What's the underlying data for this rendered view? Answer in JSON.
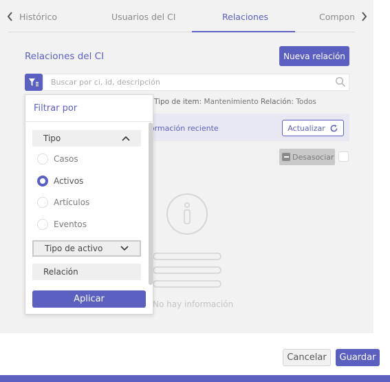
{
  "tabs": [
    {
      "label": "Histórico",
      "active": false
    },
    {
      "label": "Usuarios del CI",
      "active": false
    },
    {
      "label": "Relaciones",
      "active": true
    },
    {
      "label": "Compone",
      "active": false
    }
  ],
  "section": {
    "title": "Relaciones del CI",
    "new_button": "Nueva relación"
  },
  "search": {
    "placeholder": "Buscar por ci, id, descripción"
  },
  "filters_summary": {
    "tipo_item_label": "Tipo de item:",
    "tipo_item_value": "Mantenimiento",
    "relacion_label": "Relación:",
    "relacion_value": "Todos"
  },
  "info_bar": {
    "text": "formación reciente",
    "refresh_button": "Actualizar"
  },
  "actions": {
    "disassociate_button": "Desasociar"
  },
  "empty_state": {
    "text": "No hay información"
  },
  "filter_popup": {
    "title": "Filtrar por",
    "group_tipo": "Tipo",
    "tipo_options": [
      {
        "label": "Casos",
        "checked": false
      },
      {
        "label": "Activos",
        "checked": true
      },
      {
        "label": "Artículos",
        "checked": false
      },
      {
        "label": "Eventos",
        "checked": false
      }
    ],
    "group_tipo_activo": "Tipo de activo",
    "group_relacion": "Relación",
    "apply_button": "Aplicar"
  },
  "footer": {
    "cancel_button": "Cancelar",
    "save_button": "Guardar"
  },
  "colors": {
    "accent": "#5b5fbf",
    "panel_bg": "#f2f2f2"
  },
  "icons": [
    "chevron-left-icon",
    "chevron-right-icon",
    "filter-icon",
    "search-icon",
    "refresh-icon",
    "minus-square-icon",
    "chevron-up-icon",
    "chevron-down-icon",
    "info-icon"
  ]
}
